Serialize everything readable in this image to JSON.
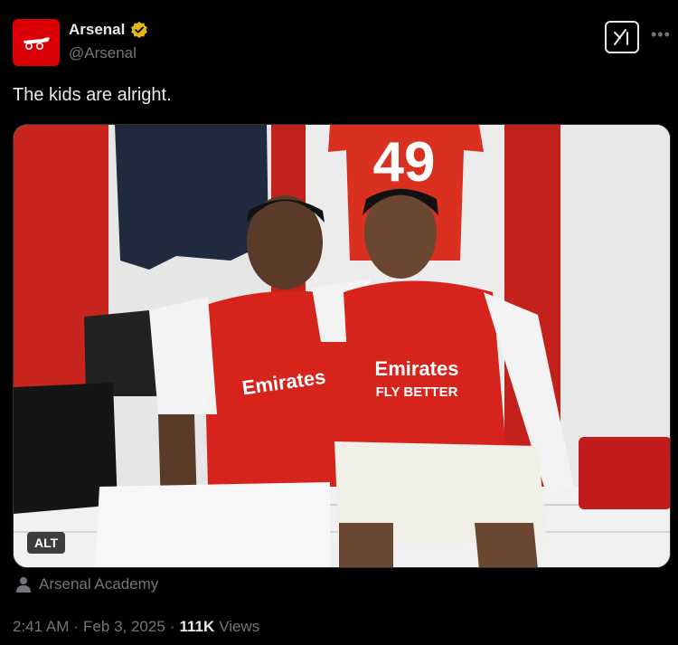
{
  "tweet": {
    "author_name": "Arsenal",
    "author_handle": "@Arsenal",
    "verified": true,
    "text": "The kids are alright.",
    "media": {
      "alt_badge": "ALT",
      "jersey_number_back": "49",
      "sponsor_line1": "Emirates",
      "sponsor_line2": "FLY BETTER"
    },
    "tagged_user": "Arsenal Academy",
    "time": "2:41 AM",
    "separator": "·",
    "date": "Feb 3, 2025",
    "views_count": "111K",
    "views_label": "Views"
  },
  "icons": {
    "avatar": "arsenal-cannon-logo",
    "verified": "gold-verified-badge-icon",
    "grok": "grok-icon",
    "more": "more-options-icon",
    "person": "person-icon"
  },
  "colors": {
    "brand_red": "#db0007",
    "verified_gold": "#e2b719",
    "muted_text": "#71767b",
    "text": "#e7e9ea"
  }
}
